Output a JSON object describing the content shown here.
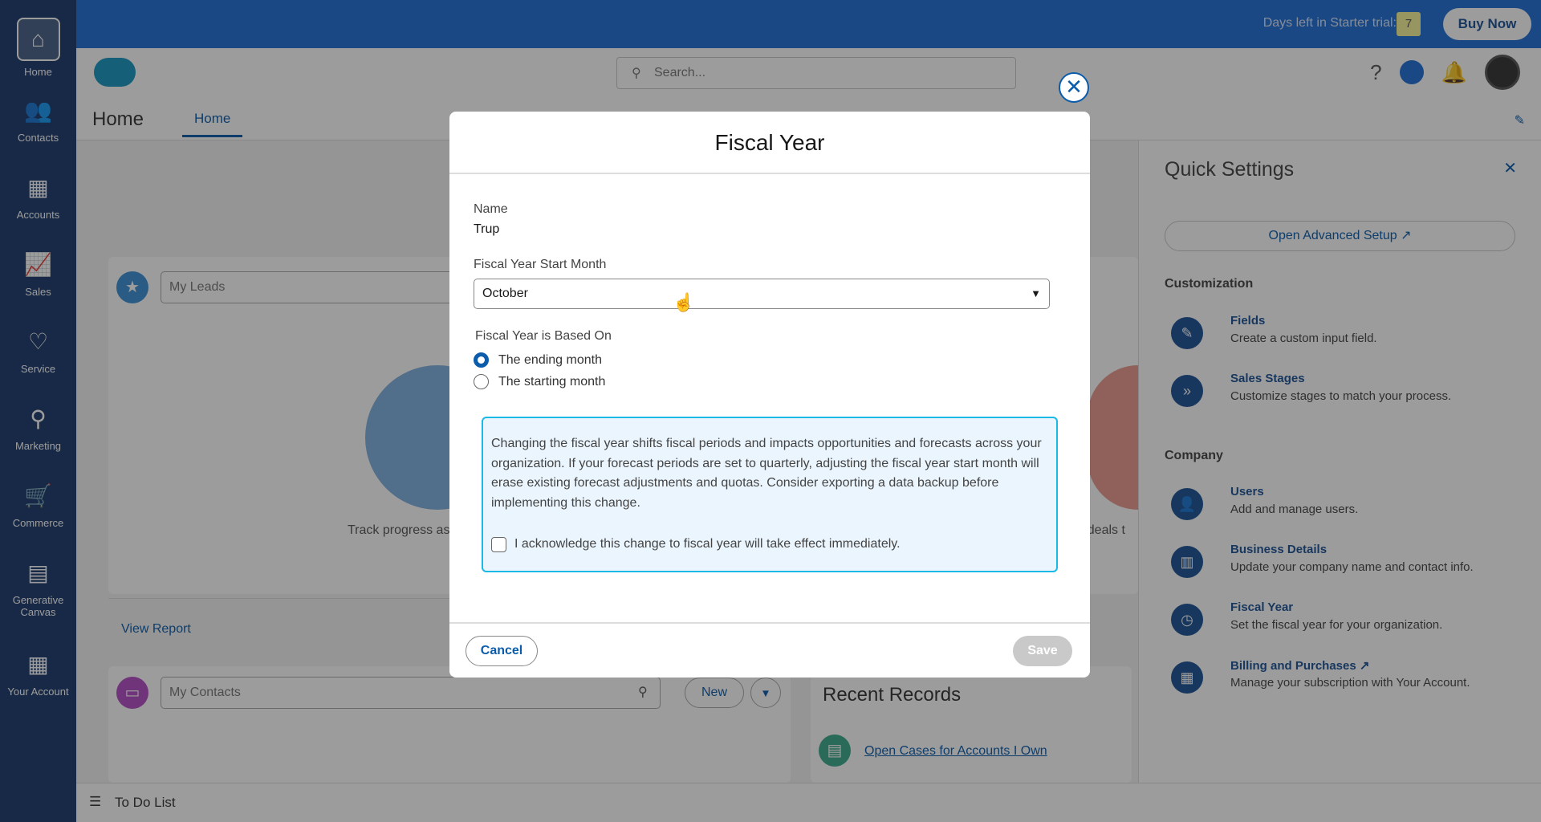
{
  "sidebar": {
    "items": [
      {
        "label": "Home",
        "icon": "home-icon",
        "glyph": "⌂"
      },
      {
        "label": "Contacts",
        "icon": "contacts-icon",
        "glyph": "👥"
      },
      {
        "label": "Accounts",
        "icon": "accounts-icon",
        "glyph": "▦"
      },
      {
        "label": "Sales",
        "icon": "sales-icon",
        "glyph": "📈"
      },
      {
        "label": "Service",
        "icon": "service-icon",
        "glyph": "♡"
      },
      {
        "label": "Marketing",
        "icon": "marketing-icon",
        "glyph": "⚲"
      },
      {
        "label": "Commerce",
        "icon": "commerce-icon",
        "glyph": "🛒"
      },
      {
        "label": "Generative Canvas",
        "icon": "canvas-icon",
        "glyph": "▤"
      },
      {
        "label": "Your Account",
        "icon": "account-icon",
        "glyph": "▦"
      }
    ]
  },
  "topbar": {
    "trial_label": "Days left in Starter trial:",
    "trial_days": "7",
    "buy_now": "Buy Now"
  },
  "header": {
    "search_placeholder": "Search...",
    "title": "Home",
    "tab": "Home"
  },
  "main": {
    "leads_placeholder": "My Leads",
    "leads_text": "Track progress as",
    "deals_text": "r deals t",
    "view_report": "View Report",
    "contacts_placeholder": "My Contacts",
    "new_button": "New",
    "recent_records": "Recent Records",
    "recent_link": "Open Cases for Accounts I Own"
  },
  "quick_settings": {
    "title": "Quick Settings",
    "advanced": "Open Advanced Setup ↗",
    "customization": "Customization",
    "company": "Company",
    "items": [
      {
        "title": "Fields",
        "desc": "Create a custom input field.",
        "glyph": "✎"
      },
      {
        "title": "Sales Stages",
        "desc": "Customize stages to match your process.",
        "glyph": "»"
      },
      {
        "title": "Users",
        "desc": "Add and manage users.",
        "glyph": "👤"
      },
      {
        "title": "Business Details",
        "desc": "Update your company name and contact info.",
        "glyph": "▥"
      },
      {
        "title": "Fiscal Year",
        "desc": "Set the fiscal year for your organization.",
        "glyph": "◷"
      },
      {
        "title": "Billing and Purchases ↗",
        "desc": "Manage your subscription with Your Account.",
        "glyph": "▦"
      }
    ]
  },
  "todo": "To Do List",
  "modal": {
    "title": "Fiscal Year",
    "name_label": "Name",
    "name_value": "Trup",
    "start_label": "Fiscal Year Start Month",
    "start_value": "October",
    "based_label": "Fiscal Year is Based On",
    "option_ending": "The ending month",
    "option_starting": "The starting month",
    "selected": "ending",
    "warning": "Changing the fiscal year shifts fiscal periods and impacts opportunities and forecasts across your organization. If your forecast periods are set to quarterly, adjusting the fiscal year start month will erase existing forecast adjustments and quotas. Consider exporting a data backup before implementing this change.",
    "acknowledge": "I acknowledge this change to fiscal year will take effect immediately.",
    "acknowledged": false,
    "cancel": "Cancel",
    "save": "Save"
  }
}
